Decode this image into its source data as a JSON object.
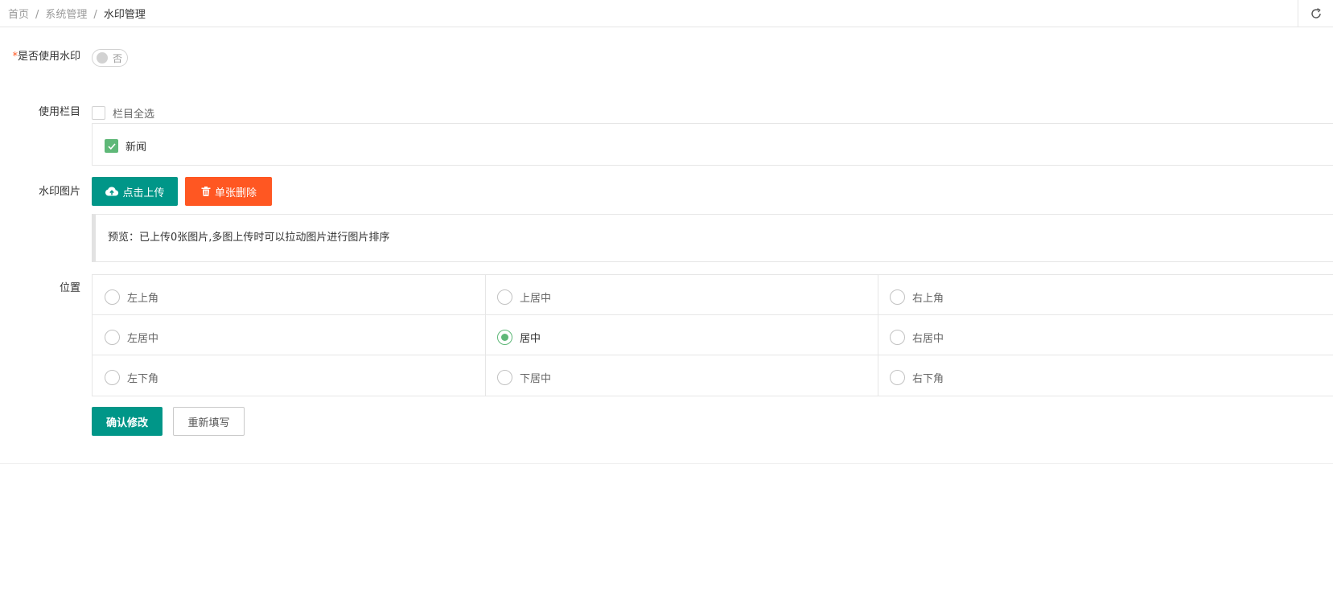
{
  "breadcrumb": {
    "home": "首页",
    "section": "系统管理",
    "current": "水印管理",
    "separator": "/"
  },
  "form": {
    "watermark_toggle": {
      "label_required_mark": "*",
      "label": "是否使用水印",
      "state_text": "否",
      "enabled": false
    },
    "columns": {
      "label": "使用栏目",
      "select_all_label": "栏目全选",
      "select_all_checked": false,
      "items": [
        {
          "label": "新闻",
          "checked": true
        }
      ]
    },
    "image": {
      "label": "水印图片",
      "upload_button": "点击上传",
      "delete_button": "单张删除",
      "preview_text": "预览：已上传0张图片,多图上传时可以拉动图片进行图片排序"
    },
    "position": {
      "label": "位置",
      "options": [
        [
          {
            "label": "左上角",
            "selected": false
          },
          {
            "label": "上居中",
            "selected": false
          },
          {
            "label": "右上角",
            "selected": false
          }
        ],
        [
          {
            "label": "左居中",
            "selected": false
          },
          {
            "label": "居中",
            "selected": true
          },
          {
            "label": "右居中",
            "selected": false
          }
        ],
        [
          {
            "label": "左下角",
            "selected": false
          },
          {
            "label": "下居中",
            "selected": false
          },
          {
            "label": "右下角",
            "selected": false
          }
        ]
      ]
    },
    "actions": {
      "confirm": "确认修改",
      "reset": "重新填写"
    }
  },
  "colors": {
    "primary": "#009688",
    "danger": "#ff5722",
    "checked": "#5fb878",
    "border": "#e6e6e6"
  },
  "icons": {
    "refresh": "refresh-icon",
    "upload": "cloud-upload-icon",
    "delete": "trash-icon",
    "check": "check-icon"
  }
}
